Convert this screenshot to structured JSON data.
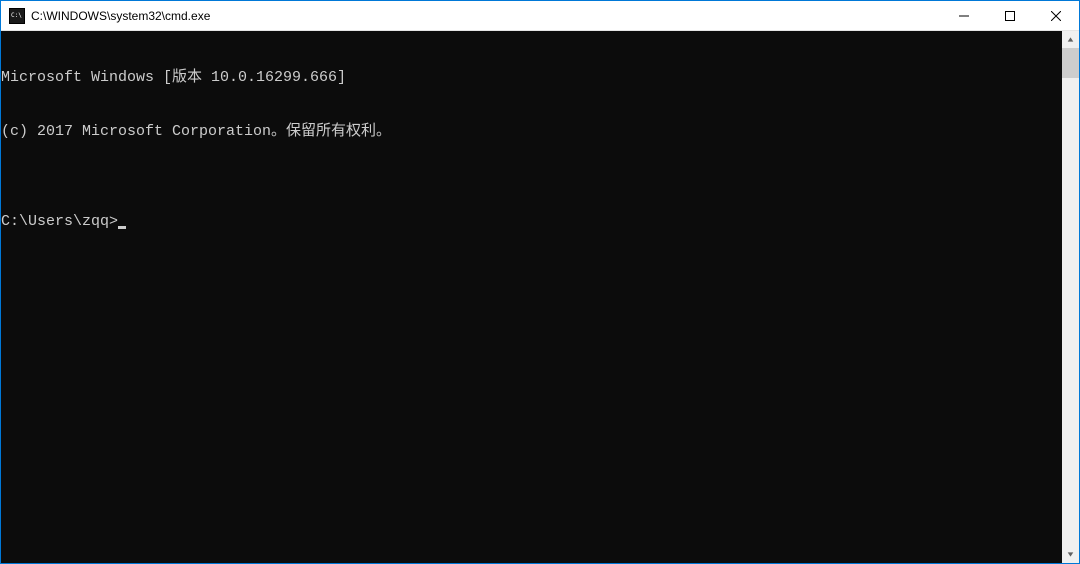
{
  "window": {
    "title": "C:\\WINDOWS\\system32\\cmd.exe"
  },
  "terminal": {
    "line1": "Microsoft Windows [版本 10.0.16299.666]",
    "line2": "(c) 2017 Microsoft Corporation。保留所有权利。",
    "blank": "",
    "prompt": "C:\\Users\\zqq>"
  }
}
